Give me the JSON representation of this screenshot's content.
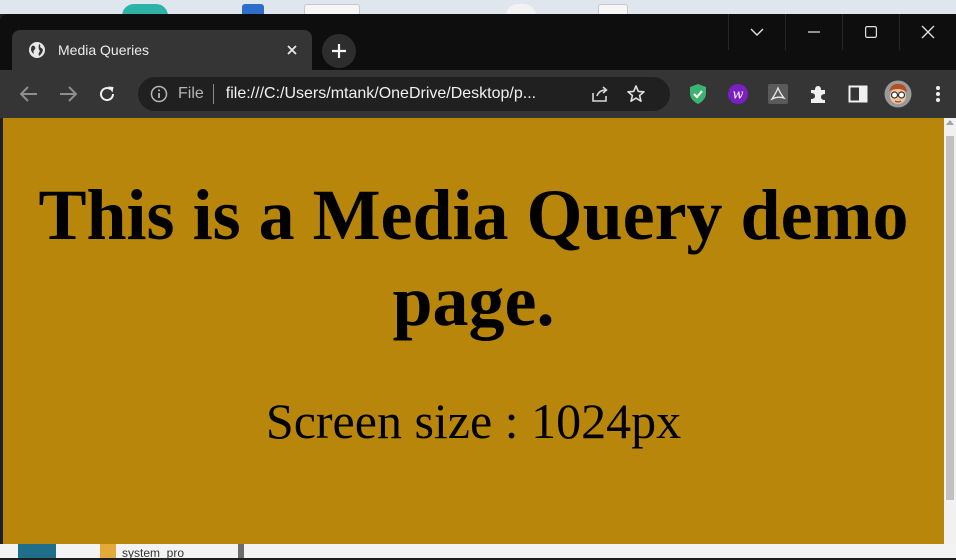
{
  "browser": {
    "tab": {
      "title": "Media Queries",
      "favicon": "globe-icon"
    },
    "window_controls": [
      "tab-search-icon",
      "minimize-icon",
      "maximize-icon",
      "close-icon"
    ],
    "address_bar": {
      "scheme_label": "File",
      "url": "file:///C:/Users/mtank/OneDrive/Desktop/p..."
    },
    "extensions": [
      "shield-extension-icon",
      "w-extension-icon",
      "pdf-extension-icon",
      "puzzle-icon",
      "sidepanel-icon",
      "profile-avatar"
    ],
    "colors": {
      "frame": "#0e0e0e",
      "toolbar": "#353535",
      "omnibox": "#202020"
    }
  },
  "page": {
    "heading": "This is a Media Query demo page.",
    "text": "Screen size : 1024px",
    "background": "#b8860b"
  },
  "desktop": {
    "partial_label": "system_pro"
  }
}
